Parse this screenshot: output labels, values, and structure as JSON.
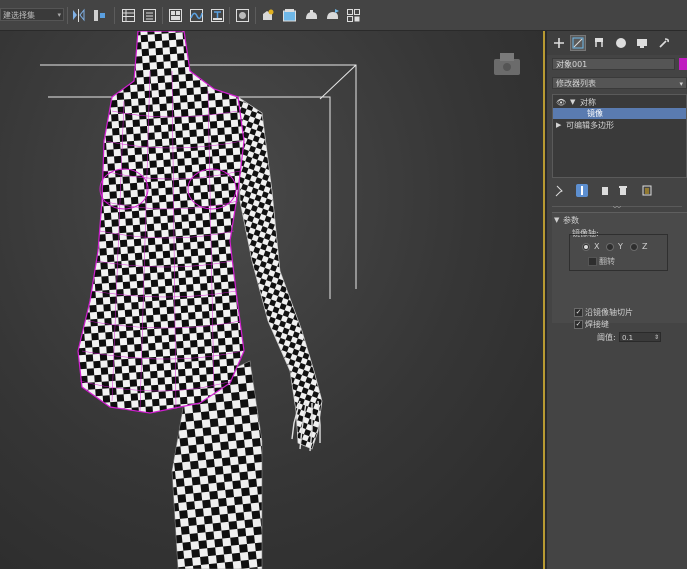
{
  "toolbar": {
    "selection_set": "建选择集",
    "icons": [
      "mirror-icon",
      "align-icon",
      "layer-manager-icon",
      "layer-icon",
      "toggle-ribbon-icon",
      "curve-editor-icon",
      "schematic-view-icon",
      "material-editor-icon",
      "render-setup-icon",
      "rendered-frame-icon",
      "render-icon",
      "render-iterative-icon",
      "snap-icon"
    ]
  },
  "viewport": {
    "label": "Perspective viewport",
    "accent_color": "#b89a32",
    "selection_color": "#c01cc0"
  },
  "command_panel": {
    "tabs": [
      "create-icon",
      "modify-icon",
      "hierarchy-icon",
      "motion-icon",
      "display-icon",
      "utilities-icon"
    ],
    "object_name": "对象001",
    "object_color": "#c01cc0",
    "modifier_list": "修改器列表",
    "stack": {
      "mirror": "对称",
      "mirror_sub": "镜像",
      "editable_poly": "可编辑多边形"
    },
    "rollout": {
      "title": "参数",
      "mirror_axis": "镜像轴:",
      "axis_x": "X",
      "axis_y": "Y",
      "axis_z": "Z",
      "flip": "翻转",
      "slice_along_mirror": "沿镜像轴切片",
      "weld_seam": "焊接缝",
      "threshold_label": "阈值:",
      "threshold_value": "0.1"
    }
  }
}
